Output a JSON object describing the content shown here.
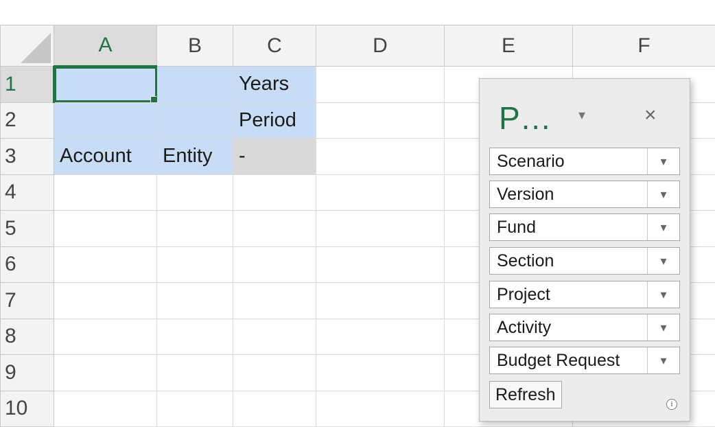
{
  "columns": [
    "A",
    "B",
    "C",
    "D",
    "E",
    "F"
  ],
  "rows": [
    "1",
    "2",
    "3",
    "4",
    "5",
    "6",
    "7",
    "8",
    "9",
    "10"
  ],
  "cells": {
    "C1": "Years",
    "C2": "Period",
    "A3": "Account",
    "B3": "Entity",
    "C3": "-"
  },
  "pov": {
    "title": "P…",
    "dropdown_glyph": "▾",
    "close_glyph": "×",
    "dimensions": [
      "Scenario",
      "Version",
      "Fund",
      "Section",
      "Project",
      "Activity",
      "Budget Request"
    ],
    "arrow_glyph": "▾",
    "refresh_label": "Refresh",
    "info_glyph": "i"
  },
  "colors": {
    "accent": "#217346",
    "selection": "#c9dcf5",
    "header_gray": "#d9d9d9"
  }
}
